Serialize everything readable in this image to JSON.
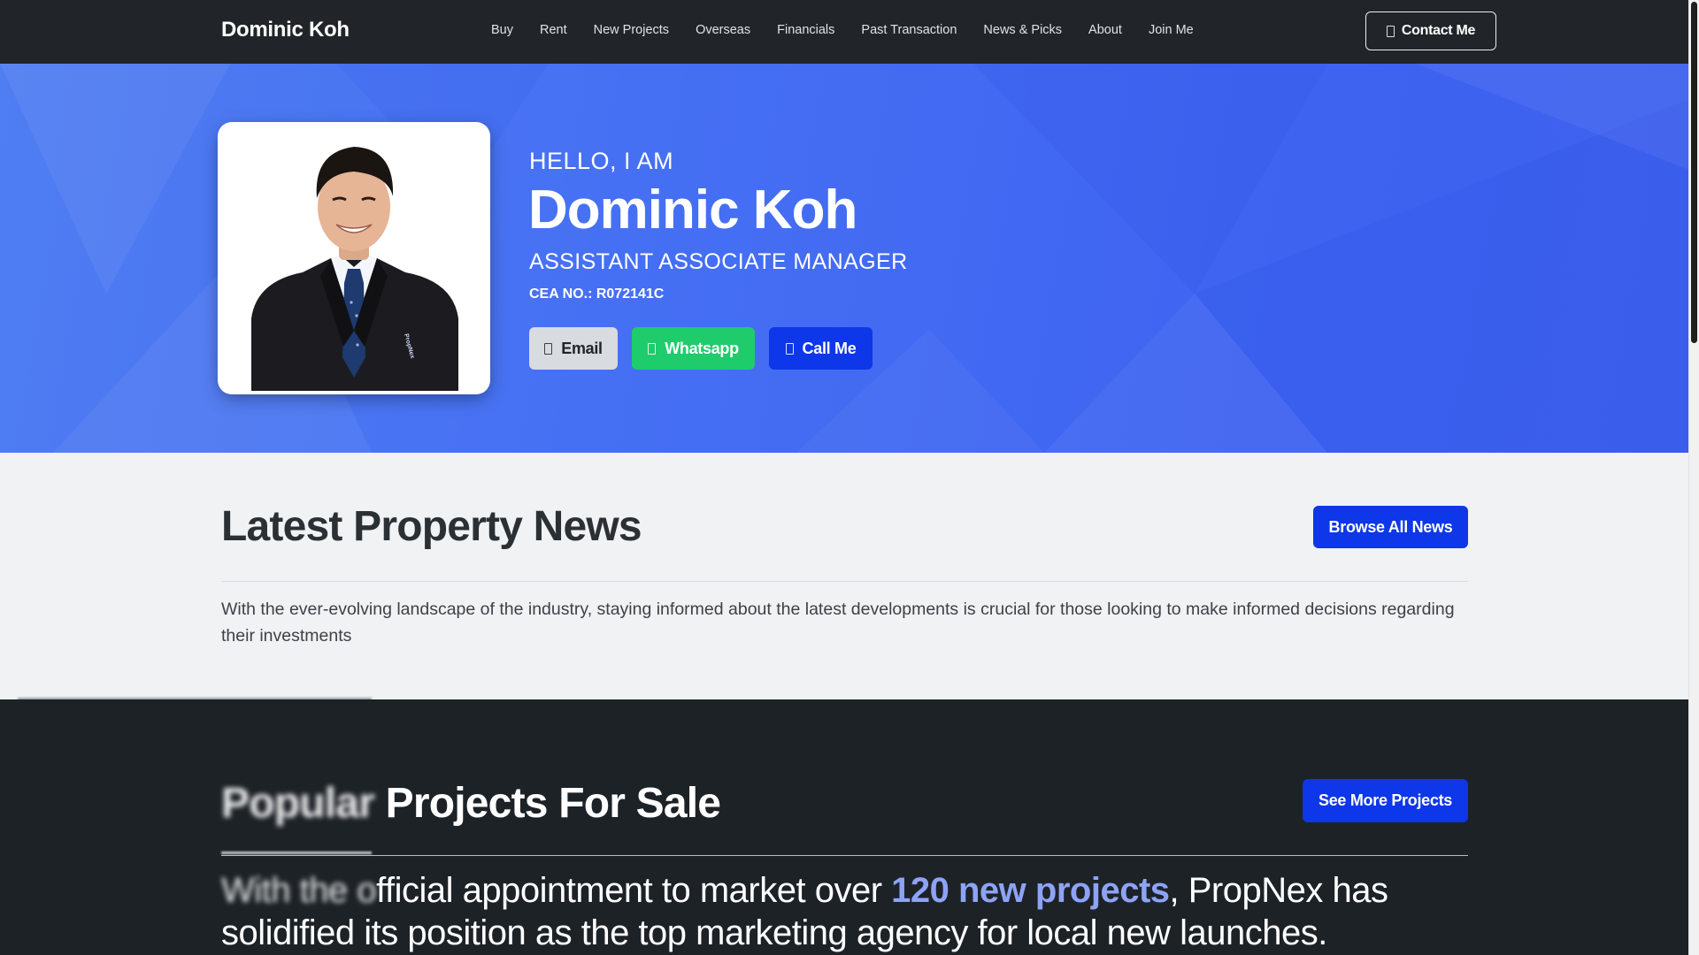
{
  "brand": "Dominic Koh",
  "nav": {
    "items": [
      "Buy",
      "Rent",
      "New Projects",
      "Overseas",
      "Financials",
      "Past Transaction",
      "News & Picks",
      "About",
      "Join Me"
    ],
    "contact_label": "Contact Me"
  },
  "hero": {
    "greeting": "HELLO, I AM",
    "name": "Dominic Koh",
    "title": "ASSISTANT ASSOCIATE MANAGER",
    "cea": "CEA NO.: R072141C",
    "buttons": {
      "email": "Email",
      "whatsapp": "Whatsapp",
      "call": "Call Me"
    },
    "photo_badge": "PropNex"
  },
  "news": {
    "heading": "Latest Property News",
    "button": "Browse All News",
    "description": "With the ever-evolving landscape of the industry, staying informed about the latest developments is crucial for those looking to make informed decisions regarding their investments"
  },
  "projects": {
    "heading_blurred": "Popular",
    "heading_rest": " Projects For Sale",
    "button": "See More Projects",
    "text_blurred": "With the o",
    "text_part1": "fficial appointment to market over ",
    "text_highlight": "120 new projects",
    "text_part2": ", PropNex has solidified its position as the top marketing agency for local new launches."
  },
  "colors": {
    "navbar": "#212529",
    "hero_blue": "#456ff3",
    "primary_button": "#0d37e8",
    "whatsapp_green": "#1fcc6c",
    "email_grey": "#d8dbe0",
    "news_bg": "#f1f2f4",
    "dark_section": "#1d2227",
    "highlight": "#8ea3f5"
  },
  "icons": {
    "email": "envelope-icon",
    "whatsapp": "whatsapp-icon",
    "call": "phone-icon",
    "contact": "user-icon"
  }
}
